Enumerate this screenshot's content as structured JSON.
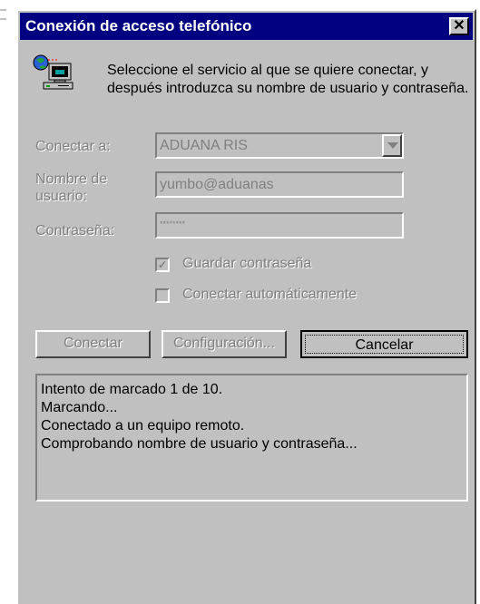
{
  "window": {
    "title": "Conexión de acceso telefónico",
    "close_glyph": "✕"
  },
  "intro_text": "Seleccione el servicio al que se quiere conectar, y después introduzca su nombre de usuario y contraseña.",
  "icons": {
    "dialup": "dialup-computer-icon",
    "close": "close-icon",
    "dropdown": "chevron-down-icon"
  },
  "form": {
    "connect_to": {
      "label": "Conectar a:",
      "value": "ADUANA RIS"
    },
    "username": {
      "label": "Nombre de usuario:",
      "value": "yumbo@aduanas"
    },
    "password": {
      "label": "Contraseña:",
      "value": "********"
    },
    "save_password": {
      "label": "Guardar contraseña",
      "checked": true,
      "mark": "✓"
    },
    "auto_connect": {
      "label": "Conectar automáticamente",
      "checked": false,
      "mark": ""
    }
  },
  "buttons": {
    "connect": "Conectar",
    "settings": "Configuración...",
    "cancel": "Cancelar"
  },
  "status": {
    "lines": [
      "Intento de marcado 1 de 10.",
      "Marcando...",
      "Conectado a un equipo remoto.",
      "Comprobando nombre de usuario y contraseña..."
    ]
  },
  "colors": {
    "titlebar": "#000080",
    "face": "#c0c0c0",
    "disabled_text": "#808080"
  }
}
